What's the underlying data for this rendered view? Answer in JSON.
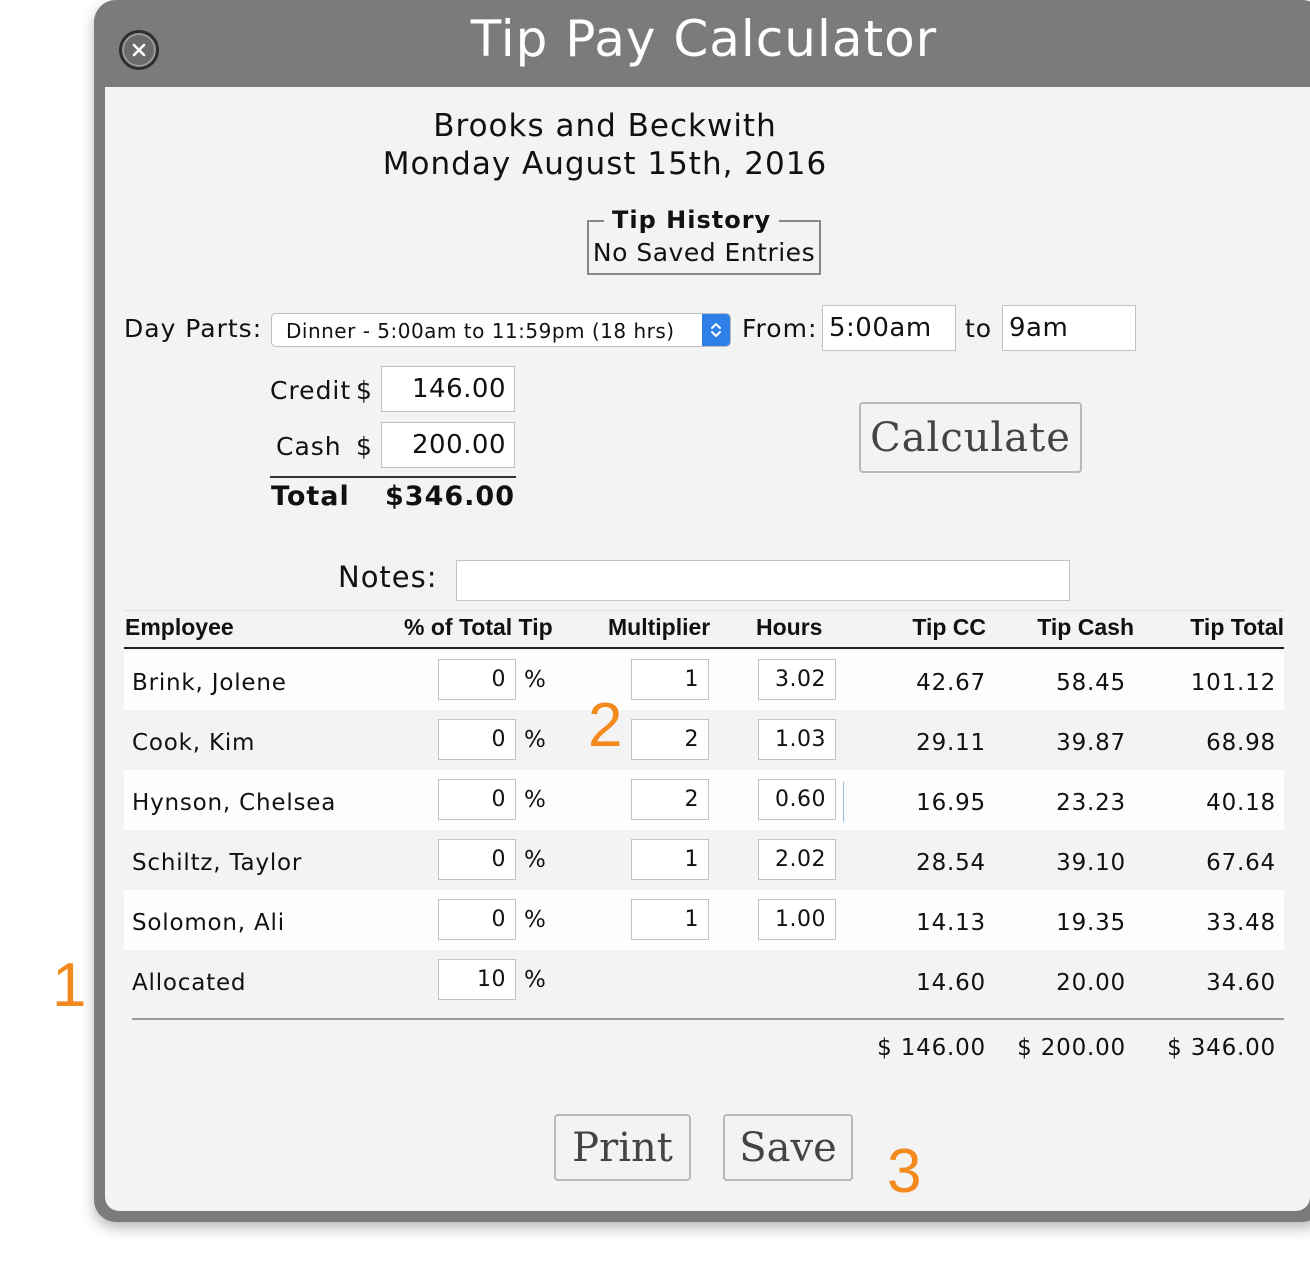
{
  "window": {
    "title": "Tip Pay Calculator"
  },
  "header": {
    "restaurant": "Brooks and Beckwith",
    "date": "Monday August 15th, 2016"
  },
  "tip_history": {
    "title": "Tip History",
    "value": "No Saved Entries"
  },
  "day_parts": {
    "label": "Day Parts:",
    "selected": "Dinner - 5:00am to 11:59pm (18 hrs)",
    "from_label": "From:",
    "from_value": "5:00am",
    "to_label": "to",
    "to_value": "9am"
  },
  "amounts": {
    "credit_label": "Credit",
    "credit_currency": "$",
    "credit_value": "146.00",
    "cash_label": "Cash",
    "cash_currency": "$",
    "cash_value": "200.00",
    "total_label": "Total",
    "total_value": "$346.00"
  },
  "calculate_label": "Calculate",
  "notes": {
    "label": "Notes:",
    "value": ""
  },
  "table": {
    "headers": [
      "Employee",
      "% of Total Tip",
      "Multiplier",
      "Hours",
      "Tip CC",
      "Tip Cash",
      "Tip Total"
    ],
    "rows": [
      {
        "employee": "Brink, Jolene",
        "pct": "0",
        "pct_sign": "%",
        "multiplier": "1",
        "hours": "3.02",
        "tip_cc": "42.67",
        "tip_cash": "58.45",
        "tip_total": "101.12"
      },
      {
        "employee": "Cook, Kim",
        "pct": "0",
        "pct_sign": "%",
        "multiplier": "2",
        "hours": "1.03",
        "tip_cc": "29.11",
        "tip_cash": "39.87",
        "tip_total": "68.98"
      },
      {
        "employee": "Hynson, Chelsea",
        "pct": "0",
        "pct_sign": "%",
        "multiplier": "2",
        "hours": "0.60",
        "tip_cc": "16.95",
        "tip_cash": "23.23",
        "tip_total": "40.18"
      },
      {
        "employee": "Schiltz, Taylor",
        "pct": "0",
        "pct_sign": "%",
        "multiplier": "1",
        "hours": "2.02",
        "tip_cc": "28.54",
        "tip_cash": "39.10",
        "tip_total": "67.64"
      },
      {
        "employee": "Solomon, Ali",
        "pct": "0",
        "pct_sign": "%",
        "multiplier": "1",
        "hours": "1.00",
        "tip_cc": "14.13",
        "tip_cash": "19.35",
        "tip_total": "33.48"
      },
      {
        "employee": "Allocated",
        "pct": "10",
        "pct_sign": "%",
        "tip_cc": "14.60",
        "tip_cash": "20.00",
        "tip_total": "34.60"
      }
    ],
    "totals": {
      "tip_cc": "$ 146.00",
      "tip_cash": "$ 200.00",
      "tip_total": "$ 346.00"
    }
  },
  "footer": {
    "print_label": "Print",
    "save_label": "Save"
  },
  "annotations": [
    "1",
    "2",
    "3"
  ],
  "colors": {
    "window_chrome": "#7b7b7b",
    "panel": "#f3f3f3",
    "select_accent": "#2f7fe8",
    "annotation": "#f28a1e"
  },
  "icons": {
    "close": "close-icon",
    "select": "select-arrows-icon"
  }
}
